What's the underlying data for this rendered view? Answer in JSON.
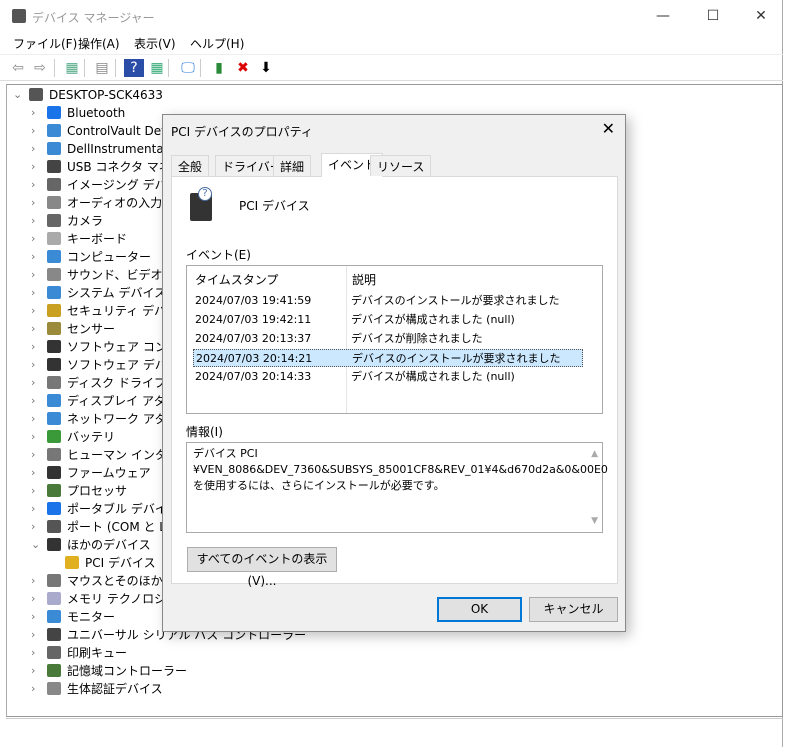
{
  "window": {
    "title": "デバイス マネージャー",
    "minimize": "—",
    "maximize": "☐",
    "close": "✕"
  },
  "menu": [
    "ファイル(F)",
    "操作(A)",
    "表示(V)",
    "ヘルプ(H)"
  ],
  "toolbar": [
    {
      "name": "back-icon",
      "g": "⇦",
      "c": "#888"
    },
    {
      "name": "forward-icon",
      "g": "⇨",
      "c": "#888"
    },
    {
      "name": "show-hide-console-tree-icon",
      "g": "▦",
      "c": "#5a8"
    },
    {
      "name": "properties-icon",
      "g": "▤",
      "c": "#888"
    },
    {
      "name": "help-icon",
      "g": "?",
      "c": "#fff",
      "bg": "#2a4ea8"
    },
    {
      "name": "action-pane-icon",
      "g": "▦",
      "c": "#3a7"
    },
    {
      "name": "scan-hardware-icon",
      "g": "🖵",
      "c": "#2a7bd6"
    },
    {
      "name": "update-driver-icon",
      "g": "▮",
      "c": "#2a8a3a"
    },
    {
      "name": "uninstall-icon",
      "g": "✖",
      "c": "#d00"
    },
    {
      "name": "disable-icon",
      "g": "⬇",
      "c": "#000"
    }
  ],
  "tree": {
    "root": "DESKTOP-SCK4633",
    "items": [
      {
        "label": "Bluetooth",
        "color": "#1a73e8"
      },
      {
        "label": "ControlVault Device",
        "color": "#3a8ad6"
      },
      {
        "label": "DellInstrumentation",
        "color": "#3a8ad6"
      },
      {
        "label": "USB コネクタ マネージャー",
        "color": "#444"
      },
      {
        "label": "イメージング デバイス",
        "color": "#666"
      },
      {
        "label": "オーディオの入力および出力",
        "color": "#888"
      },
      {
        "label": "カメラ",
        "color": "#666"
      },
      {
        "label": "キーボード",
        "color": "#aaa"
      },
      {
        "label": "コンピューター",
        "color": "#3a8ad6"
      },
      {
        "label": "サウンド、ビデオ、およびゲーム コントローラー",
        "color": "#888"
      },
      {
        "label": "システム デバイス",
        "color": "#3a8ad6"
      },
      {
        "label": "セキュリティ デバイス",
        "color": "#c9a020"
      },
      {
        "label": "センサー",
        "color": "#9a8a3a"
      },
      {
        "label": "ソフトウェア コンポーネント",
        "color": "#333"
      },
      {
        "label": "ソフトウェア デバイス",
        "color": "#333"
      },
      {
        "label": "ディスク ドライブ",
        "color": "#777"
      },
      {
        "label": "ディスプレイ アダプター",
        "color": "#3a8ad6"
      },
      {
        "label": "ネットワーク アダプター",
        "color": "#3a8ad6"
      },
      {
        "label": "バッテリ",
        "color": "#3a9a3a"
      },
      {
        "label": "ヒューマン インターフェイス デバイス",
        "color": "#777"
      },
      {
        "label": "ファームウェア",
        "color": "#333"
      },
      {
        "label": "プロセッサ",
        "color": "#4a7a3a"
      },
      {
        "label": "ポータブル デバイス",
        "color": "#1a73e8"
      },
      {
        "label": "ポート (COM と LPT)",
        "color": "#555"
      },
      {
        "label": "ほかのデバイス",
        "color": "#333",
        "expanded": true
      },
      {
        "label": "PCI デバイス",
        "color": "#e0b020",
        "child": true
      },
      {
        "label": "マウスとそのほかのポインティング デバイス",
        "color": "#777"
      },
      {
        "label": "メモリ テクノロジ デバイス",
        "color": "#aac"
      },
      {
        "label": "モニター",
        "color": "#3a8ad6"
      },
      {
        "label": "ユニバーサル シリアル バス コントローラー",
        "color": "#444"
      },
      {
        "label": "印刷キュー",
        "color": "#666"
      },
      {
        "label": "記憶域コントローラー",
        "color": "#4a7a3a"
      },
      {
        "label": "生体認証デバイス",
        "color": "#888"
      }
    ]
  },
  "dialog": {
    "title": "PCI デバイスのプロパティ",
    "close": "✕",
    "tabs": [
      "全般",
      "ドライバー",
      "詳細",
      "イベント",
      "リソース"
    ],
    "active_tab": 3,
    "device_name": "PCI デバイス",
    "events_label": "イベント(E)",
    "columns": [
      "タイムスタンプ",
      "説明"
    ],
    "events": [
      [
        "2024/07/03 19:41:59",
        "デバイスのインストールが要求されました"
      ],
      [
        "2024/07/03 19:42:11",
        "デバイスが構成されました (null)"
      ],
      [
        "2024/07/03 20:13:37",
        "デバイスが削除されました"
      ],
      [
        "2024/07/03 20:14:21",
        "デバイスのインストールが要求されました"
      ],
      [
        "2024/07/03 20:14:33",
        "デバイスが構成されました (null)"
      ]
    ],
    "selected_event": 3,
    "info_label": "情報(I)",
    "info_lines": [
      "デバイス PCI",
      "¥VEN_8086&DEV_7360&SUBSYS_85001CF8&REV_01¥4&d670d2a&0&00E0",
      "を使用するには、さらにインストールが必要です。"
    ],
    "show_all_button": "すべてのイベントの表示(V)...",
    "ok": "OK",
    "cancel": "キャンセル"
  }
}
